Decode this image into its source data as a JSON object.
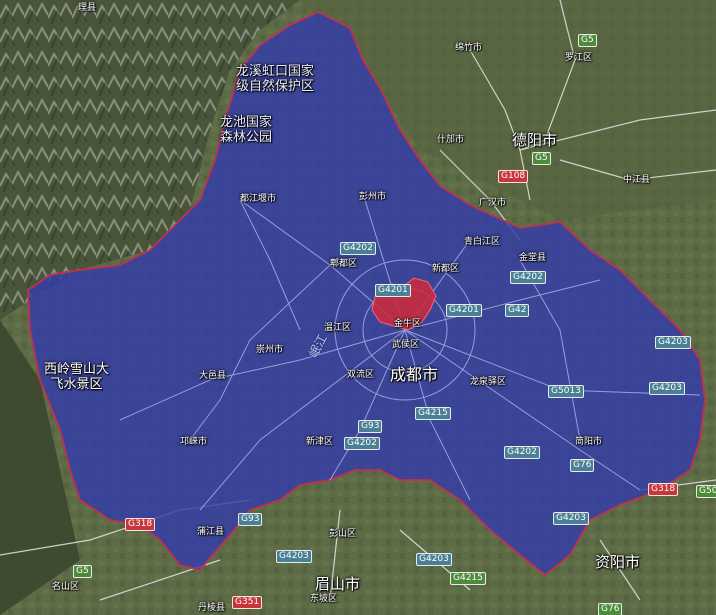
{
  "colors": {
    "region_fill": "#333ca8",
    "region_border": "#c03050",
    "core_fill": "#cc2a3c",
    "terrain_dark": "#3f4d33",
    "terrain_mid": "#5e6b45",
    "mountain_light": "#a9ab9e",
    "road": "#f2f2f2"
  },
  "map": {
    "region_label": "成都市",
    "core_label": "金牛区",
    "river_label": "岷江",
    "cities": [
      {
        "id": "lixian",
        "label": "理县",
        "size": "sm"
      },
      {
        "id": "mianzhu",
        "label": "绵竹市",
        "size": "sm"
      },
      {
        "id": "luojiang",
        "label": "罗江区",
        "size": "sm"
      },
      {
        "id": "shifang",
        "label": "什邡市",
        "size": "sm"
      },
      {
        "id": "deyang",
        "label": "德阳市",
        "size": "lg"
      },
      {
        "id": "zhongjiang",
        "label": "中江县",
        "size": "sm"
      },
      {
        "id": "guanghan",
        "label": "广汉市",
        "size": "sm"
      },
      {
        "id": "dujiangyan",
        "label": "都江堰市",
        "size": "sm"
      },
      {
        "id": "pengzhou",
        "label": "彭州市",
        "size": "sm"
      },
      {
        "id": "qingbaijiang",
        "label": "青白江区",
        "size": "sm"
      },
      {
        "id": "jintang",
        "label": "金堂县",
        "size": "sm"
      },
      {
        "id": "pidu",
        "label": "郫都区",
        "size": "sm"
      },
      {
        "id": "xindu",
        "label": "新都区",
        "size": "sm"
      },
      {
        "id": "wenjiang",
        "label": "温江区",
        "size": "sm"
      },
      {
        "id": "chongzhou",
        "label": "崇州市",
        "size": "sm"
      },
      {
        "id": "wuhou",
        "label": "武侯区",
        "size": "sm"
      },
      {
        "id": "dayi",
        "label": "大邑县",
        "size": "sm"
      },
      {
        "id": "shuangliu",
        "label": "双流区",
        "size": "sm"
      },
      {
        "id": "longquanyi",
        "label": "龙泉驿区",
        "size": "sm"
      },
      {
        "id": "qionglai",
        "label": "邛崃市",
        "size": "sm"
      },
      {
        "id": "xinjin",
        "label": "新津区",
        "size": "sm"
      },
      {
        "id": "jianyang",
        "label": "简阳市",
        "size": "sm"
      },
      {
        "id": "pujiang",
        "label": "蒲江县",
        "size": "sm"
      },
      {
        "id": "pengshan",
        "label": "彭山区",
        "size": "sm"
      },
      {
        "id": "mingshan",
        "label": "名山区",
        "size": "sm"
      },
      {
        "id": "meishan",
        "label": "眉山市",
        "size": "lg"
      },
      {
        "id": "dongpo",
        "label": "东坡区",
        "size": "sm"
      },
      {
        "id": "danleng",
        "label": "丹棱县",
        "size": "sm"
      },
      {
        "id": "ziyang",
        "label": "资阳市",
        "size": "lg"
      }
    ],
    "parks": [
      {
        "id": "longxi",
        "lines": [
          "龙溪虹口国家",
          "级自然保护区"
        ]
      },
      {
        "id": "longchi",
        "lines": [
          "龙池国家",
          "森林公园"
        ]
      },
      {
        "id": "xiling",
        "lines": [
          "西岭雪山大",
          "飞水景区"
        ]
      }
    ],
    "highways": [
      {
        "id": "g5_top",
        "label": "G5",
        "kind": "g"
      },
      {
        "id": "g5_deyang",
        "label": "G5",
        "kind": "g"
      },
      {
        "id": "g108",
        "label": "G108",
        "kind": "r"
      },
      {
        "id": "g4202_n",
        "label": "G4202",
        "kind": "b"
      },
      {
        "id": "g4201_n",
        "label": "G4201",
        "kind": "b"
      },
      {
        "id": "g4201_e",
        "label": "G4201",
        "kind": "b"
      },
      {
        "id": "g42",
        "label": "G42",
        "kind": "b"
      },
      {
        "id": "g4202_ne",
        "label": "G4202",
        "kind": "b"
      },
      {
        "id": "g4203_e",
        "label": "G4203",
        "kind": "b"
      },
      {
        "id": "g5013",
        "label": "G5013",
        "kind": "b"
      },
      {
        "id": "g4203_e2",
        "label": "G4203",
        "kind": "b"
      },
      {
        "id": "g93_c",
        "label": "G93",
        "kind": "b"
      },
      {
        "id": "g4215_c",
        "label": "G4215",
        "kind": "b"
      },
      {
        "id": "g4202_s",
        "label": "G4202",
        "kind": "b"
      },
      {
        "id": "g4202_se",
        "label": "G4202",
        "kind": "b"
      },
      {
        "id": "g76_a",
        "label": "G76",
        "kind": "b"
      },
      {
        "id": "g318_e",
        "label": "G318",
        "kind": "r"
      },
      {
        "id": "g50",
        "label": "G50",
        "kind": "g"
      },
      {
        "id": "g318_w",
        "label": "G318",
        "kind": "r"
      },
      {
        "id": "g93_s",
        "label": "G93",
        "kind": "b"
      },
      {
        "id": "g4203_se",
        "label": "G4203",
        "kind": "b"
      },
      {
        "id": "g5_s",
        "label": "G5",
        "kind": "g"
      },
      {
        "id": "g4203_s",
        "label": "G4203",
        "kind": "b"
      },
      {
        "id": "g4203_s2",
        "label": "G4203",
        "kind": "b"
      },
      {
        "id": "g4215_s",
        "label": "G4215",
        "kind": "g"
      },
      {
        "id": "g351",
        "label": "G351",
        "kind": "r"
      },
      {
        "id": "g76_b",
        "label": "G76",
        "kind": "g"
      }
    ]
  }
}
